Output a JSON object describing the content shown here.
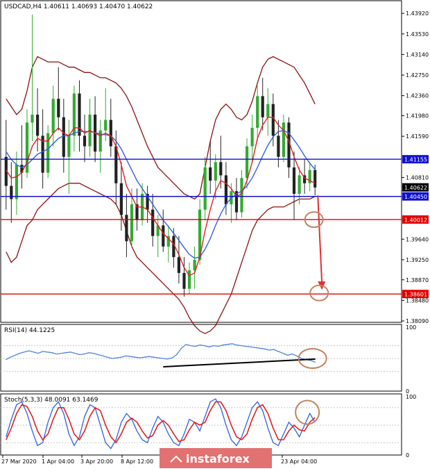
{
  "chart_data": [
    {
      "type": "candlestick",
      "symbol": "USDCAD,H4",
      "ohlc_header": "1.40611 1.40693 1.40470 1.40622",
      "title": "USDCAD,H4  1.40611 1.40693 1.40470 1.40622",
      "ylim": [
        1.3809,
        1.4412
      ],
      "y_ticks": [
        1.4392,
        1.4353,
        1.4314,
        1.4275,
        1.4236,
        1.4198,
        1.4159,
        1.4081,
        1.3964,
        1.3925,
        1.3887,
        1.3848,
        1.3809
      ],
      "y_tick_labels": [
        "1.43920",
        "1.43530",
        "1.43140",
        "1.42750",
        "1.42360",
        "1.41980",
        "1.41590",
        "1.40810",
        "1.39640",
        "1.39250",
        "1.38870",
        "1.38480",
        "1.38090"
      ],
      "x_labels": [
        "27 Mar 2020",
        "1 Apr 04:00",
        "3 Apr 20:00",
        "8 Apr 12:00",
        "23 Apr 04:00"
      ],
      "colors": {
        "bull": "#33aa33",
        "bear": "#222222",
        "ma_fast": "#e02020",
        "ma_slow": "#3060e0",
        "bands": "#8b1010"
      },
      "candles": [
        {
          "o": 1.412,
          "h": 1.419,
          "l": 1.402,
          "c": 1.4065
        },
        {
          "o": 1.4065,
          "h": 1.411,
          "l": 1.3995,
          "c": 1.404
        },
        {
          "o": 1.404,
          "h": 1.413,
          "l": 1.401,
          "c": 1.4105
        },
        {
          "o": 1.4105,
          "h": 1.418,
          "l": 1.406,
          "c": 1.409
        },
        {
          "o": 1.409,
          "h": 1.421,
          "l": 1.408,
          "c": 1.4185
        },
        {
          "o": 1.4185,
          "h": 1.439,
          "l": 1.415,
          "c": 1.42
        },
        {
          "o": 1.42,
          "h": 1.425,
          "l": 1.413,
          "c": 1.416
        },
        {
          "o": 1.416,
          "h": 1.421,
          "l": 1.406,
          "c": 1.409
        },
        {
          "o": 1.409,
          "h": 1.418,
          "l": 1.408,
          "c": 1.4165
        },
        {
          "o": 1.4165,
          "h": 1.4255,
          "l": 1.414,
          "c": 1.423
        },
        {
          "o": 1.423,
          "h": 1.429,
          "l": 1.417,
          "c": 1.4195
        },
        {
          "o": 1.4195,
          "h": 1.423,
          "l": 1.409,
          "c": 1.412
        },
        {
          "o": 1.412,
          "h": 1.419,
          "l": 1.405,
          "c": 1.416
        },
        {
          "o": 1.416,
          "h": 1.4255,
          "l": 1.413,
          "c": 1.424
        },
        {
          "o": 1.424,
          "h": 1.4265,
          "l": 1.413,
          "c": 1.416
        },
        {
          "o": 1.416,
          "h": 1.42,
          "l": 1.411,
          "c": 1.414
        },
        {
          "o": 1.414,
          "h": 1.423,
          "l": 1.412,
          "c": 1.42
        },
        {
          "o": 1.42,
          "h": 1.4235,
          "l": 1.411,
          "c": 1.413
        },
        {
          "o": 1.413,
          "h": 1.419,
          "l": 1.409,
          "c": 1.417
        },
        {
          "o": 1.417,
          "h": 1.425,
          "l": 1.415,
          "c": 1.419
        },
        {
          "o": 1.419,
          "h": 1.423,
          "l": 1.412,
          "c": 1.414
        },
        {
          "o": 1.414,
          "h": 1.417,
          "l": 1.403,
          "c": 1.407
        },
        {
          "o": 1.407,
          "h": 1.411,
          "l": 1.398,
          "c": 1.401
        },
        {
          "o": 1.401,
          "h": 1.405,
          "l": 1.393,
          "c": 1.396
        },
        {
          "o": 1.396,
          "h": 1.406,
          "l": 1.395,
          "c": 1.403
        },
        {
          "o": 1.403,
          "h": 1.406,
          "l": 1.398,
          "c": 1.4
        },
        {
          "o": 1.4,
          "h": 1.407,
          "l": 1.399,
          "c": 1.405
        },
        {
          "o": 1.405,
          "h": 1.4065,
          "l": 1.3995,
          "c": 1.402
        },
        {
          "o": 1.402,
          "h": 1.405,
          "l": 1.395,
          "c": 1.397
        },
        {
          "o": 1.397,
          "h": 1.401,
          "l": 1.393,
          "c": 1.399
        },
        {
          "o": 1.399,
          "h": 1.402,
          "l": 1.394,
          "c": 1.395
        },
        {
          "o": 1.395,
          "h": 1.399,
          "l": 1.392,
          "c": 1.397
        },
        {
          "o": 1.397,
          "h": 1.3985,
          "l": 1.391,
          "c": 1.393
        },
        {
          "o": 1.393,
          "h": 1.397,
          "l": 1.388,
          "c": 1.39
        },
        {
          "o": 1.39,
          "h": 1.393,
          "l": 1.3855,
          "c": 1.387
        },
        {
          "o": 1.387,
          "h": 1.392,
          "l": 1.386,
          "c": 1.3905
        },
        {
          "o": 1.3905,
          "h": 1.395,
          "l": 1.387,
          "c": 1.3925
        },
        {
          "o": 1.3925,
          "h": 1.404,
          "l": 1.3915,
          "c": 1.402
        },
        {
          "o": 1.402,
          "h": 1.412,
          "l": 1.4,
          "c": 1.41
        },
        {
          "o": 1.41,
          "h": 1.415,
          "l": 1.405,
          "c": 1.4075
        },
        {
          "o": 1.4075,
          "h": 1.4125,
          "l": 1.404,
          "c": 1.411
        },
        {
          "o": 1.411,
          "h": 1.416,
          "l": 1.406,
          "c": 1.4085
        },
        {
          "o": 1.4085,
          "h": 1.411,
          "l": 1.401,
          "c": 1.403
        },
        {
          "o": 1.403,
          "h": 1.407,
          "l": 1.3995,
          "c": 1.4055
        },
        {
          "o": 1.4055,
          "h": 1.408,
          "l": 1.4,
          "c": 1.4015
        },
        {
          "o": 1.4015,
          "h": 1.4095,
          "l": 1.4005,
          "c": 1.408
        },
        {
          "o": 1.408,
          "h": 1.4155,
          "l": 1.406,
          "c": 1.414
        },
        {
          "o": 1.414,
          "h": 1.42,
          "l": 1.411,
          "c": 1.4175
        },
        {
          "o": 1.4175,
          "h": 1.4255,
          "l": 1.415,
          "c": 1.4235
        },
        {
          "o": 1.4235,
          "h": 1.427,
          "l": 1.417,
          "c": 1.4195
        },
        {
          "o": 1.4195,
          "h": 1.425,
          "l": 1.416,
          "c": 1.422
        },
        {
          "o": 1.422,
          "h": 1.424,
          "l": 1.414,
          "c": 1.416
        },
        {
          "o": 1.416,
          "h": 1.419,
          "l": 1.41,
          "c": 1.412
        },
        {
          "o": 1.412,
          "h": 1.42,
          "l": 1.411,
          "c": 1.4185
        },
        {
          "o": 1.4185,
          "h": 1.4195,
          "l": 1.408,
          "c": 1.41
        },
        {
          "o": 1.41,
          "h": 1.413,
          "l": 1.4,
          "c": 1.405
        },
        {
          "o": 1.405,
          "h": 1.41,
          "l": 1.403,
          "c": 1.4085
        },
        {
          "o": 1.4085,
          "h": 1.4115,
          "l": 1.405,
          "c": 1.407
        },
        {
          "o": 1.407,
          "h": 1.411,
          "l": 1.4055,
          "c": 1.4095
        },
        {
          "o": 1.4095,
          "h": 1.4105,
          "l": 1.4047,
          "c": 1.4062
        }
      ],
      "series": [
        {
          "name": "",
          "values": [
            1.4095,
            1.408,
            1.4082,
            1.409,
            1.411,
            1.414,
            1.4155,
            1.415,
            1.415,
            1.4165,
            1.4175,
            1.4165,
            1.416,
            1.4175,
            1.4175,
            1.4165,
            1.417,
            1.4165,
            1.416,
            1.4165,
            1.416,
            1.414,
            1.4105,
            1.4065,
            1.4045,
            1.4025,
            1.4025,
            1.402,
            1.4005,
            1.399,
            1.3975,
            1.3965,
            1.3955,
            1.3935,
            1.391,
            1.3895,
            1.39,
            1.393,
            1.398,
            1.402,
            1.4055,
            1.4075,
            1.407,
            1.406,
            1.4045,
            1.405,
            1.4075,
            1.411,
            1.4155,
            1.418,
            1.4195,
            1.4195,
            1.418,
            1.417,
            1.415,
            1.412,
            1.4095,
            1.408,
            1.4075,
            1.407
          ]
        },
        {
          "name": "",
          "values": [
            1.413,
            1.4115,
            1.4105,
            1.41,
            1.4105,
            1.4115,
            1.4125,
            1.413,
            1.4135,
            1.4145,
            1.4155,
            1.416,
            1.416,
            1.4165,
            1.4168,
            1.4168,
            1.4168,
            1.4166,
            1.4163,
            1.4162,
            1.416,
            1.415,
            1.4135,
            1.4115,
            1.4095,
            1.4075,
            1.406,
            1.4045,
            1.403,
            1.4015,
            1.4,
            1.3988,
            1.3975,
            1.3962,
            1.3948,
            1.3935,
            1.3928,
            1.393,
            1.3945,
            1.3965,
            1.399,
            1.4012,
            1.403,
            1.4042,
            1.405,
            1.4055,
            1.4065,
            1.408,
            1.41,
            1.4122,
            1.4142,
            1.4158,
            1.4168,
            1.417,
            1.4165,
            1.4152,
            1.4138,
            1.4122,
            1.4108,
            1.4096
          ]
        }
      ],
      "bands_upper": [
        1.423,
        1.4215,
        1.42,
        1.421,
        1.4245,
        1.429,
        1.431,
        1.4305,
        1.43,
        1.43,
        1.43,
        1.4295,
        1.429,
        1.429,
        1.4285,
        1.428,
        1.428,
        1.4275,
        1.427,
        1.427,
        1.4265,
        1.426,
        1.425,
        1.4235,
        1.4215,
        1.419,
        1.4165,
        1.414,
        1.412,
        1.41,
        1.409,
        1.408,
        1.407,
        1.406,
        1.405,
        1.4045,
        1.404,
        1.405,
        1.41,
        1.415,
        1.419,
        1.421,
        1.422,
        1.421,
        1.4195,
        1.419,
        1.42,
        1.4225,
        1.426,
        1.429,
        1.4305,
        1.431,
        1.4305,
        1.43,
        1.4295,
        1.429,
        1.4275,
        1.426,
        1.424,
        1.422
      ],
      "bands_lower": [
        1.394,
        1.392,
        1.393,
        1.396,
        1.399,
        1.4,
        1.402,
        1.403,
        1.404,
        1.405,
        1.406,
        1.4065,
        1.407,
        1.407,
        1.407,
        1.4065,
        1.406,
        1.4055,
        1.405,
        1.4045,
        1.404,
        1.403,
        1.401,
        1.398,
        1.395,
        1.393,
        1.392,
        1.391,
        1.39,
        1.389,
        1.388,
        1.387,
        1.386,
        1.385,
        1.3835,
        1.3815,
        1.38,
        1.379,
        1.3785,
        1.379,
        1.38,
        1.382,
        1.384,
        1.386,
        1.389,
        1.392,
        1.395,
        1.398,
        1.4,
        1.401,
        1.402,
        1.4025,
        1.4025,
        1.4025,
        1.403,
        1.4035,
        1.404,
        1.404,
        1.404,
        1.4045
      ],
      "levels": [
        {
          "value": 1.41155,
          "label": "1.41155",
          "color": "#1010d0"
        },
        {
          "value": 1.4045,
          "label": "1.40450",
          "color": "#1010d0"
        },
        {
          "value": 1.40012,
          "label": "1.40012",
          "color": "#e00000"
        },
        {
          "value": 1.38601,
          "label": "1.38601",
          "color": "#e00000"
        }
      ],
      "current_price": {
        "value": 1.40622,
        "label": "1.40622"
      },
      "arrow": {
        "from": 1.4047,
        "to": 1.3868,
        "color": "#e03030"
      },
      "circles": [
        {
          "index": 58,
          "value": 1.4001
        },
        {
          "index": 59,
          "value": 1.3862
        }
      ],
      "grid": false,
      "legend": "none"
    },
    {
      "type": "line",
      "title": "RSI(14) 44.1225",
      "ylim": [
        0,
        100
      ],
      "y_ticks": [
        100,
        0
      ],
      "y_tick_labels": [
        "100",
        "0"
      ],
      "levels": [
        70,
        50,
        30
      ],
      "color": "#5080e0",
      "values": [
        48,
        52,
        55,
        58,
        60,
        62,
        60,
        58,
        61,
        60,
        59,
        57,
        58,
        59,
        60,
        58,
        56,
        57,
        59,
        58,
        56,
        54,
        52,
        50,
        51,
        52,
        54,
        53,
        52,
        51,
        52,
        53,
        52,
        51,
        50,
        49,
        51,
        56,
        66,
        72,
        70,
        69,
        71,
        70,
        68,
        70,
        69,
        71,
        72,
        73,
        71,
        70,
        69,
        68,
        67,
        66,
        65,
        63,
        64,
        61,
        58,
        55,
        57,
        54,
        50,
        48,
        47,
        44
      ],
      "trendline": {
        "from_index": 30,
        "from_value": 37,
        "to_index": 58,
        "to_value": 49,
        "color": "#000000"
      },
      "circle": {
        "index": 58,
        "value": 50
      }
    },
    {
      "type": "line",
      "title": "Stoch(5,3,3) 48.0091 63.1469",
      "ylim": [
        0,
        100
      ],
      "y_ticks": [
        100,
        0
      ],
      "y_tick_labels": [
        "100",
        "0"
      ],
      "levels": [
        80,
        50,
        20
      ],
      "series": [
        {
          "name": "",
          "color": "#3060e0",
          "values": [
            30,
            60,
            85,
            90,
            70,
            40,
            15,
            20,
            55,
            80,
            90,
            70,
            35,
            15,
            30,
            65,
            85,
            80,
            50,
            20,
            10,
            25,
            55,
            70,
            60,
            40,
            25,
            20,
            45,
            65,
            55,
            35,
            20,
            15,
            35,
            60,
            55,
            40,
            65,
            90,
            95,
            80,
            50,
            25,
            15,
            30,
            55,
            80,
            90,
            75,
            45,
            20,
            15,
            35,
            55,
            45,
            30,
            50,
            70,
            55
          ]
        },
        {
          "name": "",
          "color": "#e02020",
          "values": [
            25,
            45,
            70,
            85,
            82,
            65,
            40,
            25,
            35,
            60,
            80,
            80,
            60,
            35,
            25,
            40,
            65,
            80,
            75,
            50,
            30,
            20,
            35,
            55,
            62,
            55,
            40,
            28,
            32,
            50,
            58,
            50,
            35,
            22,
            25,
            42,
            55,
            50,
            55,
            75,
            90,
            90,
            75,
            50,
            30,
            25,
            35,
            60,
            80,
            85,
            70,
            45,
            25,
            25,
            40,
            50,
            42,
            40,
            55,
            63
          ]
        }
      ],
      "circle": {
        "index": 57,
        "value": 72
      }
    }
  ],
  "watermark": {
    "text": "instaforex",
    "bg": "#e27171"
  }
}
